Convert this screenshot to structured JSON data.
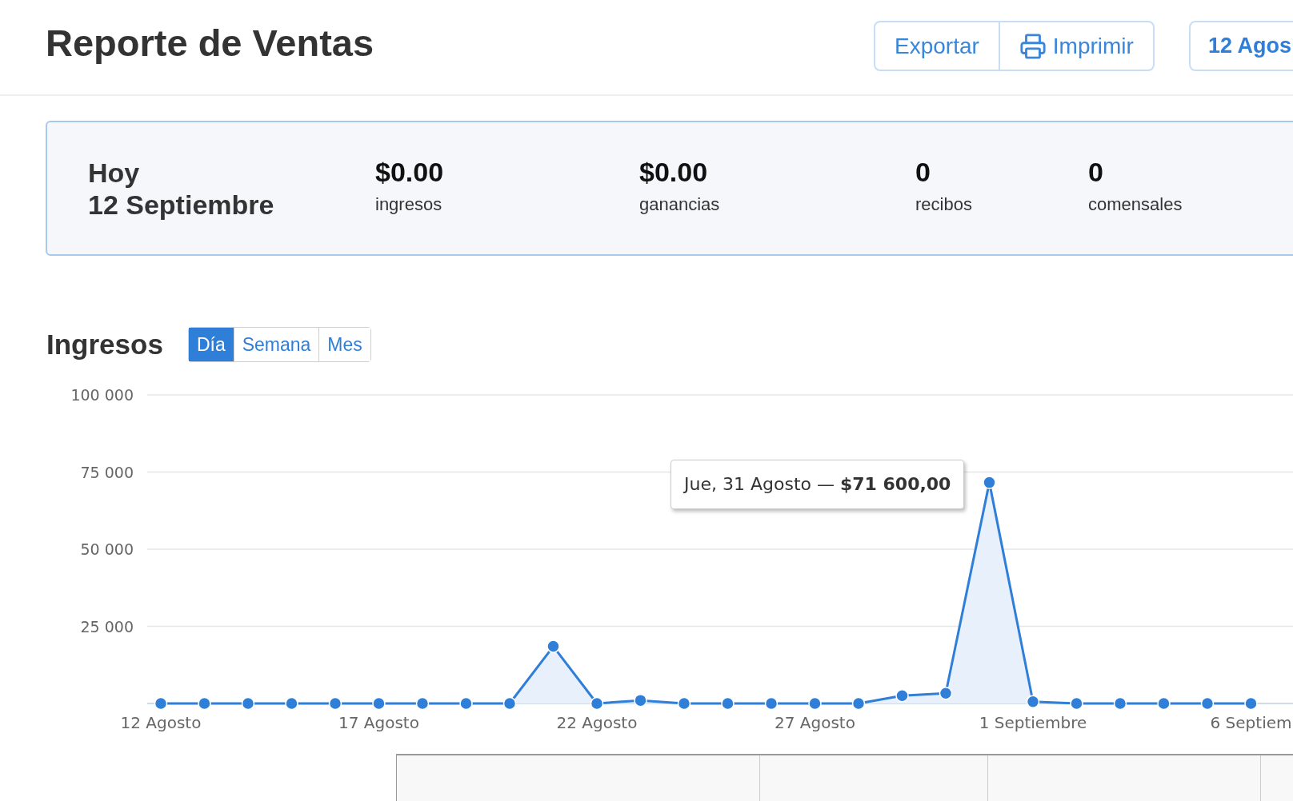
{
  "header": {
    "title": "Reporte de Ventas",
    "actions": [
      {
        "kind": "text",
        "label": "Exportar"
      },
      {
        "kind": "print",
        "label": "Imprimir"
      }
    ],
    "date_range": "12 Agos"
  },
  "summary": {
    "day": "Hoy",
    "date": "12 Septiembre",
    "stats": [
      {
        "value": "$0.00",
        "label": "ingresos"
      },
      {
        "value": "$0.00",
        "label": "ganancias"
      },
      {
        "value": "0",
        "label": "recibos"
      },
      {
        "value": "0",
        "label": "comensales"
      }
    ]
  },
  "revenue": {
    "title": "Ingresos",
    "tabs": [
      {
        "label": "Día",
        "selected": true
      },
      {
        "label": "Semana",
        "selected": false
      },
      {
        "label": "Mes",
        "selected": false
      }
    ],
    "chart_data": {
      "type": "area",
      "categories": [
        "12 Agosto",
        null,
        null,
        null,
        null,
        "17 Agosto",
        null,
        null,
        null,
        null,
        "22 Agosto",
        null,
        null,
        null,
        null,
        "27 Agosto",
        null,
        null,
        null,
        null,
        "1 Septiembre",
        null,
        null,
        null,
        null,
        "6 Septiem"
      ],
      "series": [
        {
          "color": "#2f7ed8",
          "values": [
            0,
            0,
            0,
            0,
            0,
            0,
            0,
            0,
            0,
            18500,
            0,
            1000,
            0,
            0,
            0,
            0,
            0,
            2500,
            3300,
            71600,
            600,
            0,
            0,
            0,
            0,
            0
          ]
        }
      ],
      "ylim": [
        0,
        100000
      ],
      "grid": true,
      "yticks": [
        {
          "value": 25000,
          "label": "25 000"
        },
        {
          "value": 50000,
          "label": "50 000"
        },
        {
          "value": 75000,
          "label": "75 000"
        },
        {
          "value": 100000,
          "label": "100 000"
        }
      ]
    },
    "tooltip": "Jue, 31 Agosto — **$71 600,00**"
  }
}
